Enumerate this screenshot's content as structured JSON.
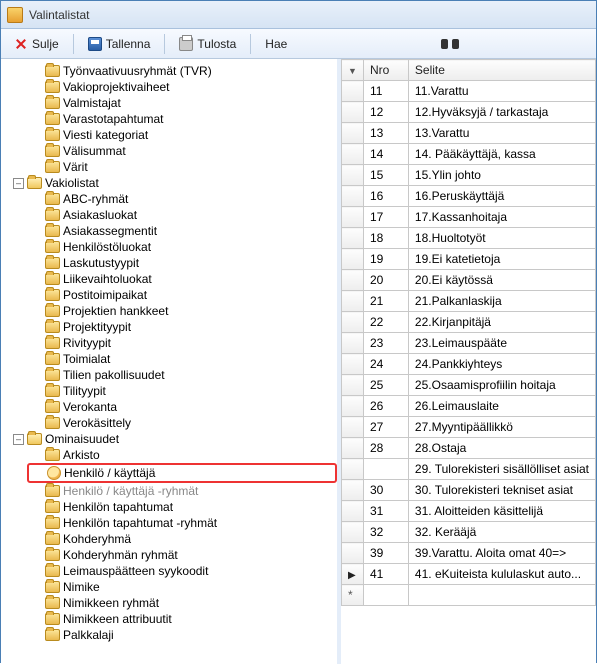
{
  "window": {
    "title": "Valintalistat"
  },
  "toolbar": {
    "close": "Sulje",
    "save": "Tallenna",
    "print": "Tulosta",
    "search": "Hae"
  },
  "tree": {
    "top_items": [
      "Työnvaativuusryhmät (TVR)",
      "Vakioprojektivaiheet",
      "Valmistajat",
      "Varastotapahtumat",
      "Viesti kategoriat",
      "Välisummat",
      "Värit"
    ],
    "vakiolistat": {
      "label": "Vakiolistat",
      "children": [
        "ABC-ryhmät",
        "Asiakasluokat",
        "Asiakassegmentit",
        "Henkilöstöluokat",
        "Laskutustyypit",
        "Liikevaihtoluokat",
        "Postitoimipaikat",
        "Projektien hankkeet",
        "Projektityypit",
        "Rivityypit",
        "Toimialat",
        "Tilien pakollisuudet",
        "Tilityypit",
        "Verokanta",
        "Verokäsittely"
      ]
    },
    "ominaisuudet": {
      "label": "Ominaisuudet",
      "children": [
        "Arkisto",
        "Henkilö / käyttäjä",
        "Henkilö / käyttäjä -ryhmät",
        "Henkilön tapahtumat",
        "Henkilön tapahtumat -ryhmät",
        "Kohderyhmä",
        "Kohderyhmän ryhmät",
        "Leimauspäätteen syykoodit",
        "Nimike",
        "Nimikkeen ryhmät",
        "Nimikkeen attribuutit",
        "Palkkalaji"
      ],
      "highlighted_index": 1
    }
  },
  "grid": {
    "columns": {
      "nro": "Nro",
      "selite": "Selite"
    },
    "rows": [
      {
        "nro": "11",
        "selite": "11.Varattu"
      },
      {
        "nro": "12",
        "selite": "12.Hyväksyjä / tarkastaja"
      },
      {
        "nro": "13",
        "selite": "13.Varattu"
      },
      {
        "nro": "14",
        "selite": "14. Pääkäyttäjä, kassa"
      },
      {
        "nro": "15",
        "selite": "15.Ylin johto"
      },
      {
        "nro": "16",
        "selite": "16.Peruskäyttäjä"
      },
      {
        "nro": "17",
        "selite": "17.Kassanhoitaja"
      },
      {
        "nro": "18",
        "selite": "18.Huoltotyöt"
      },
      {
        "nro": "19",
        "selite": "19.Ei katetietoja"
      },
      {
        "nro": "20",
        "selite": "20.Ei käytössä"
      },
      {
        "nro": "21",
        "selite": "21.Palkanlaskija"
      },
      {
        "nro": "22",
        "selite": "22.Kirjanpitäjä"
      },
      {
        "nro": "23",
        "selite": "23.Leimauspääte"
      },
      {
        "nro": "24",
        "selite": "24.Pankkiyhteys"
      },
      {
        "nro": "25",
        "selite": "25.Osaamisprofiilin hoitaja"
      },
      {
        "nro": "26",
        "selite": "26.Leimauslaite"
      },
      {
        "nro": "27",
        "selite": "27.Myyntipäällikkö"
      },
      {
        "nro": "28",
        "selite": "28.Ostaja"
      },
      {
        "nro": "",
        "selite": "29. Tulorekisteri sisällölliset asiat"
      },
      {
        "nro": "30",
        "selite": "30. Tulorekisteri tekniset asiat"
      },
      {
        "nro": "31",
        "selite": "31. Aloitteiden käsittelijä"
      },
      {
        "nro": "32",
        "selite": "32. Kerääjä"
      },
      {
        "nro": "39",
        "selite": "39.Varattu. Aloita omat 40=>"
      },
      {
        "nro": "41",
        "selite": "41. eKuiteista kululaskut auto...",
        "current": true
      }
    ]
  }
}
